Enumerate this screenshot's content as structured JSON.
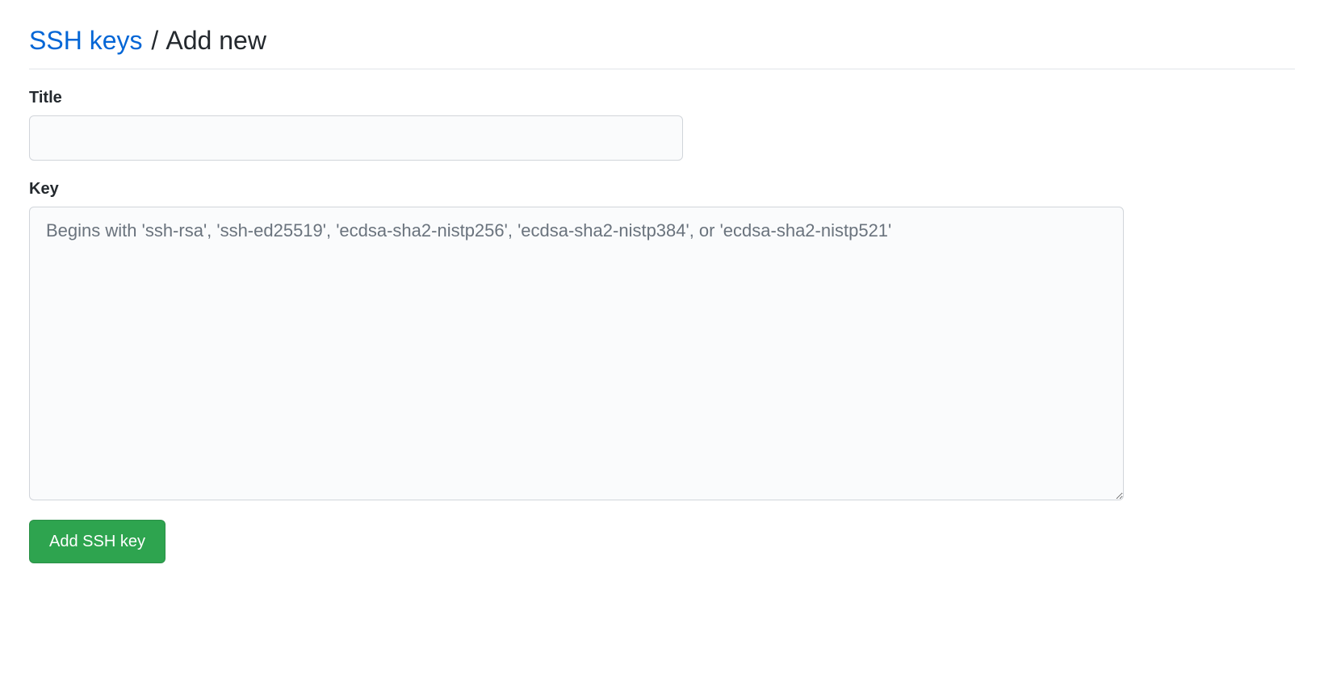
{
  "breadcrumb": {
    "parent_label": "SSH keys",
    "separator": "/",
    "current_label": "Add new"
  },
  "form": {
    "title": {
      "label": "Title",
      "value": ""
    },
    "key": {
      "label": "Key",
      "value": "",
      "placeholder": "Begins with 'ssh-rsa', 'ssh-ed25519', 'ecdsa-sha2-nistp256', 'ecdsa-sha2-nistp384', or 'ecdsa-sha2-nistp521'"
    },
    "submit_label": "Add SSH key"
  }
}
